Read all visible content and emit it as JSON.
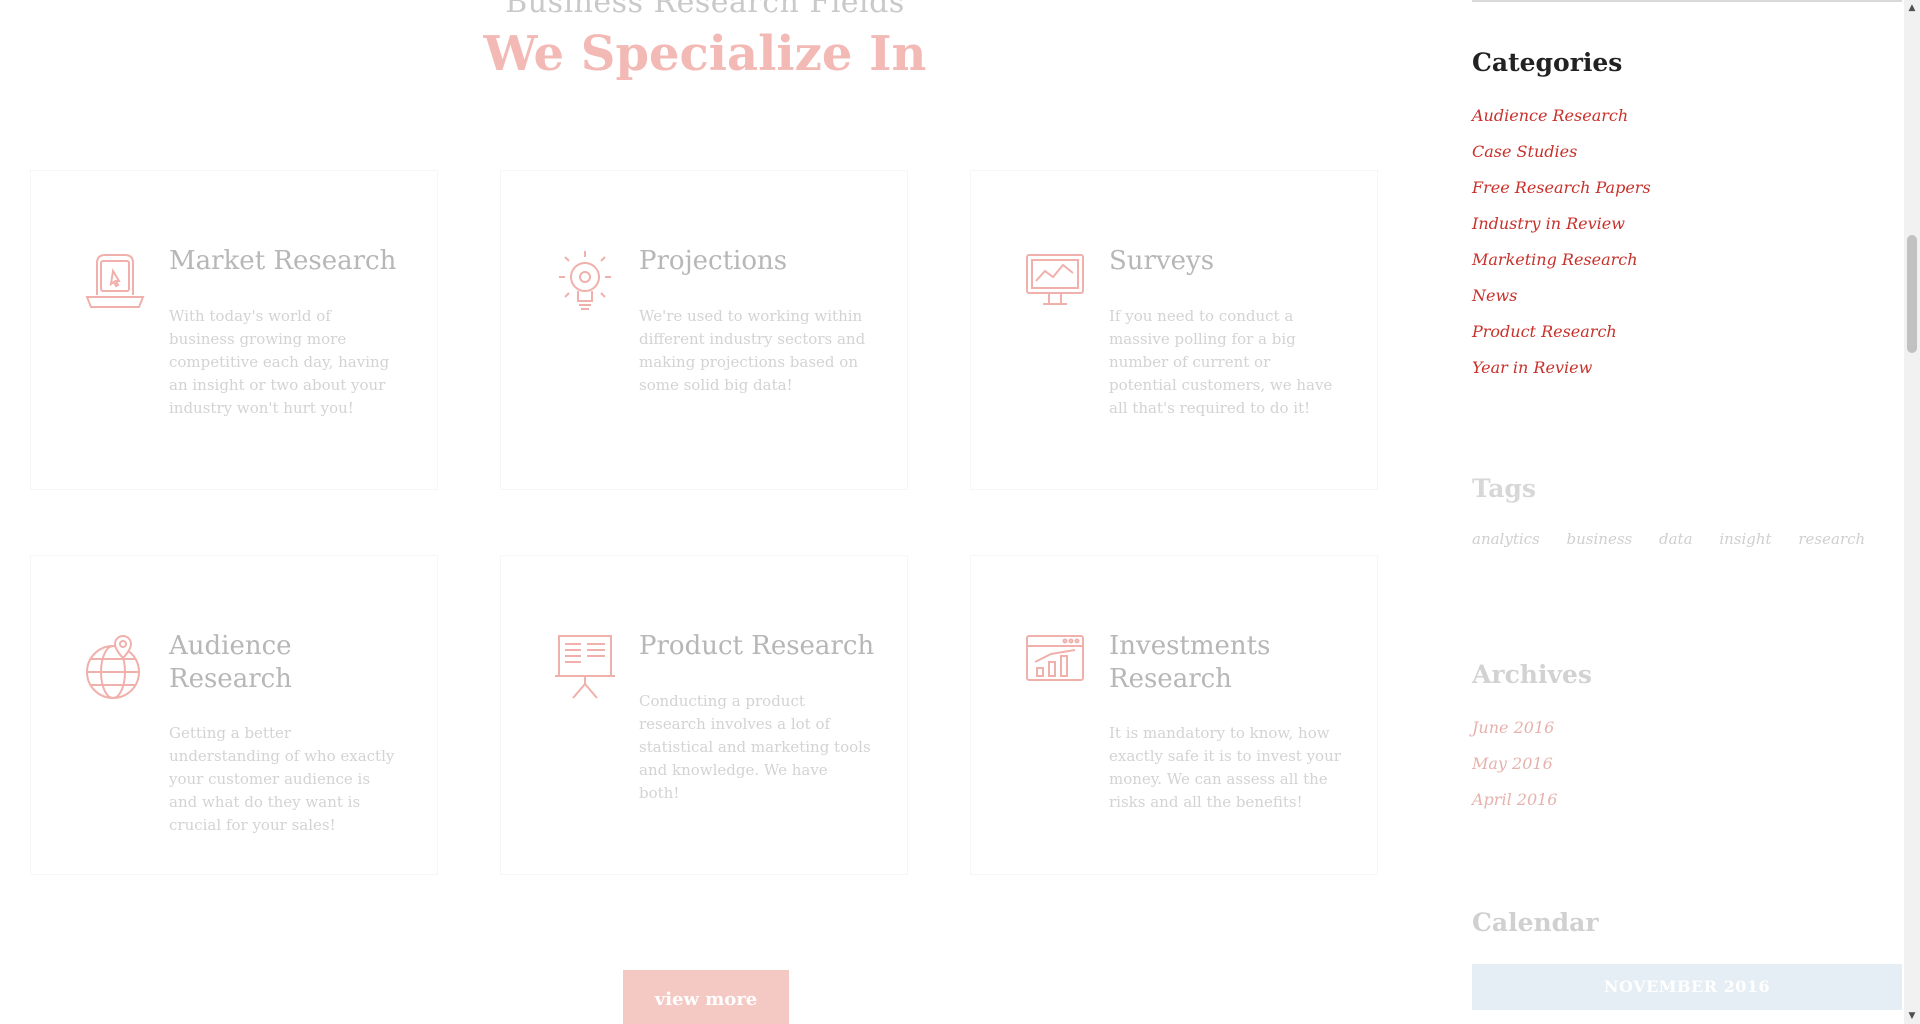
{
  "section": {
    "pretitle": "Business Research Fields",
    "title": "We Specialize In",
    "view_more_label": "view more"
  },
  "services": [
    {
      "icon": "laptop-mouse-icon",
      "title": "Market Research",
      "text": "With today's world of business growing more competitive each day, having an insight or two about your industry won't hurt you!"
    },
    {
      "icon": "lightbulb-gear-icon",
      "title": "Projections",
      "text": "We're used to working within different industry sectors and making projections based on some solid big data!"
    },
    {
      "icon": "monitor-chart-icon",
      "title": "Surveys",
      "text": "If you need to conduct a massive polling for a big number of current or potential customers, we have all that's required to do it!"
    },
    {
      "icon": "globe-pin-icon",
      "title": "Audience Research",
      "text": "Getting a better understanding of who exactly your customer audience is and what do they want is crucial for your sales!"
    },
    {
      "icon": "presentation-board-icon",
      "title": "Product Research",
      "text": "Conducting a product research involves a lot of statistical and marketing tools and knowledge. We have both!"
    },
    {
      "icon": "browser-chart-icon",
      "title": "Investments Research",
      "text": "It is mandatory to know, how exactly safe it is to invest your money. We can assess all the risks and all the benefits!"
    }
  ],
  "sidebar": {
    "categories_title": "Categories",
    "categories": [
      "Audience Research",
      "Case Studies",
      "Free Research Papers",
      "Industry in Review",
      "Marketing Research",
      "News",
      "Product Research",
      "Year in Review"
    ],
    "tags_title": "Tags",
    "tags": [
      "analytics",
      "business",
      "data",
      "insight",
      "research"
    ],
    "archives_title": "Archives",
    "archives": [
      "June 2016",
      "May 2016",
      "April 2016"
    ],
    "calendar_title": "Calendar",
    "calendar_month": "NOVEMBER 2016"
  },
  "colors": {
    "accent": "#c8312b",
    "accent_faded": "#f2b9b5",
    "calendar_header": "#e4eef4"
  }
}
